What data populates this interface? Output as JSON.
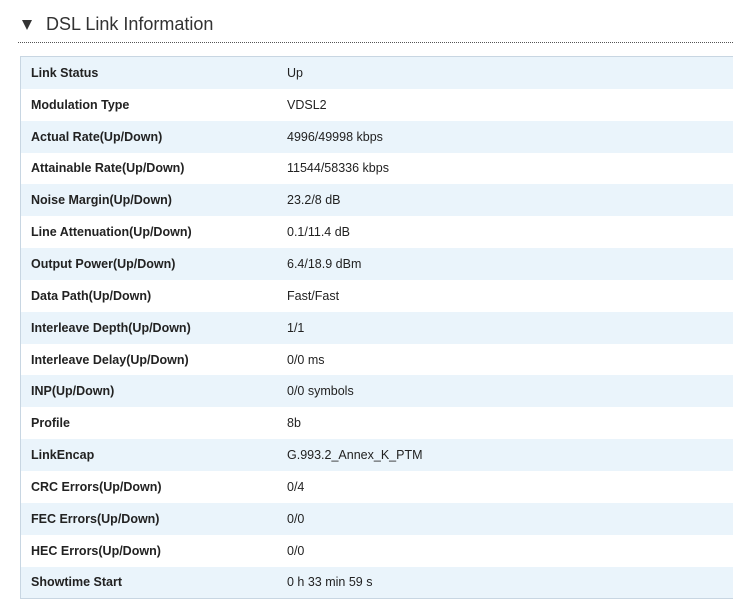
{
  "section": {
    "title": "DSL Link Information",
    "icon": "triangle-down-icon"
  },
  "rows": [
    {
      "label": "Link Status",
      "value": "Up"
    },
    {
      "label": "Modulation Type",
      "value": "VDSL2"
    },
    {
      "label": "Actual Rate(Up/Down)",
      "value": "4996/49998 kbps"
    },
    {
      "label": "Attainable Rate(Up/Down)",
      "value": "11544/58336 kbps"
    },
    {
      "label": "Noise Margin(Up/Down)",
      "value": "23.2/8 dB"
    },
    {
      "label": "Line Attenuation(Up/Down)",
      "value": "0.1/11.4 dB"
    },
    {
      "label": "Output Power(Up/Down)",
      "value": "6.4/18.9 dBm"
    },
    {
      "label": "Data Path(Up/Down)",
      "value": "Fast/Fast"
    },
    {
      "label": "Interleave Depth(Up/Down)",
      "value": "1/1"
    },
    {
      "label": "Interleave Delay(Up/Down)",
      "value": "0/0 ms"
    },
    {
      "label": "INP(Up/Down)",
      "value": "0/0 symbols"
    },
    {
      "label": "Profile",
      "value": "8b"
    },
    {
      "label": "LinkEncap",
      "value": "G.993.2_Annex_K_PTM"
    },
    {
      "label": "CRC Errors(Up/Down)",
      "value": "0/4"
    },
    {
      "label": "FEC Errors(Up/Down)",
      "value": "0/0"
    },
    {
      "label": "HEC Errors(Up/Down)",
      "value": "0/0"
    },
    {
      "label": "Showtime Start",
      "value": "0 h 33 min 59 s"
    }
  ],
  "colors": {
    "row_alt": "#eaf4fb",
    "border": "#c8d6e2",
    "text": "#222222"
  }
}
